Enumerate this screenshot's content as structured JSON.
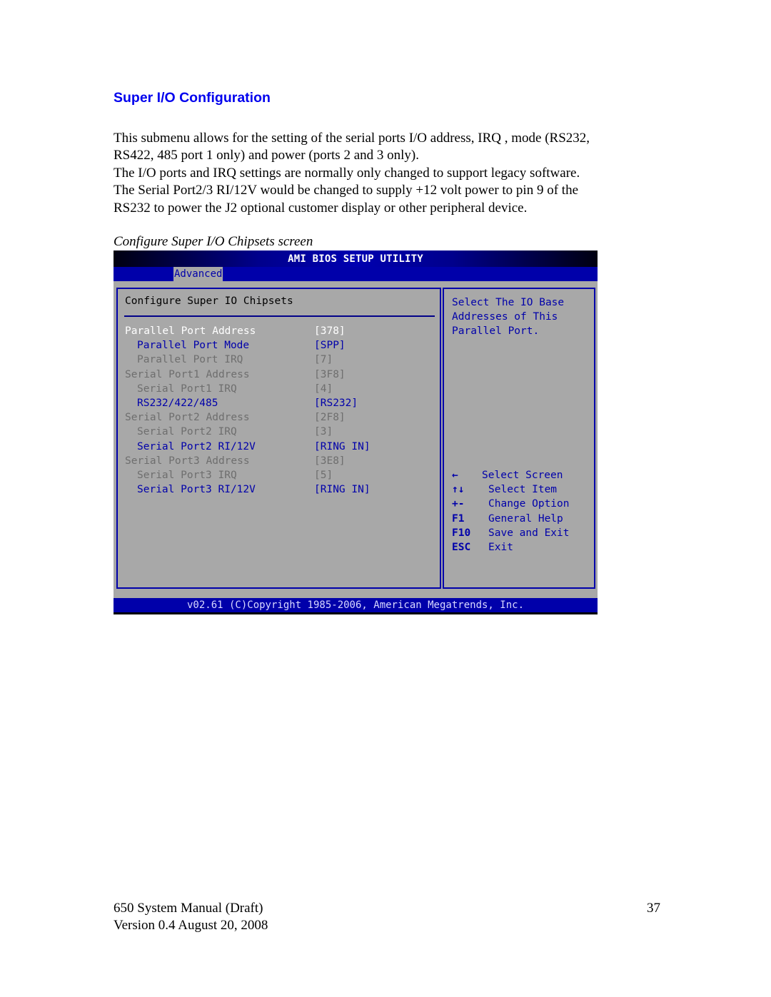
{
  "section": {
    "title": "Super I/O Configuration",
    "paragraph_lines": [
      "This submenu allows for the setting of the serial ports  I/O address, IRQ , mode (RS232,",
      "RS422, 485 port 1 only) and power (ports 2 and 3 only).",
      "The I/O ports and IRQ settings are normally only changed to support legacy software.",
      "The Serial Port2/3 RI/12V would be changed to supply +12 volt power to pin 9 of the",
      "RS232 to power the J2 optional customer display or other peripheral device."
    ],
    "caption": "Configure Super I/O Chipsets screen"
  },
  "bios": {
    "title": "AMI BIOS SETUP UTILITY",
    "active_tab": "Advanced",
    "heading": "Configure Super IO Chipsets",
    "items": [
      {
        "label": "Parallel Port Address",
        "value": "[378]",
        "state": "selected",
        "indent": 0
      },
      {
        "label": "Parallel Port Mode",
        "value": "[SPP]",
        "state": "enabled",
        "indent": 1
      },
      {
        "label": "Parallel Port IRQ",
        "value": "[7]",
        "state": "disabled",
        "indent": 1
      },
      {
        "label": "Serial Port1 Address",
        "value": "[3F8]",
        "state": "disabled",
        "indent": 0
      },
      {
        "label": "Serial Port1 IRQ",
        "value": "[4]",
        "state": "disabled",
        "indent": 1
      },
      {
        "label": "RS232/422/485",
        "value": "[RS232]",
        "state": "enabled",
        "indent": 1
      },
      {
        "label": "Serial Port2 Address",
        "value": "[2F8]",
        "state": "disabled",
        "indent": 0
      },
      {
        "label": "Serial Port2 IRQ",
        "value": "[3]",
        "state": "disabled",
        "indent": 1
      },
      {
        "label": "Serial Port2 RI/12V",
        "value": "[RING IN]",
        "state": "enabled",
        "indent": 1
      },
      {
        "label": "Serial Port3 Address",
        "value": "[3E8]",
        "state": "disabled",
        "indent": 0
      },
      {
        "label": "Serial Port3 IRQ",
        "value": "[5]",
        "state": "disabled",
        "indent": 1
      },
      {
        "label": "Serial Port3 RI/12V",
        "value": "[RING IN]",
        "state": "enabled",
        "indent": 1
      }
    ],
    "help_lines": [
      "Select The IO Base",
      "Addresses of This",
      "Parallel Port."
    ],
    "keys": [
      {
        "key": "←",
        "desc": "Select Screen"
      },
      {
        "key": "↑↓",
        "desc": "Select Item"
      },
      {
        "key": "+-",
        "desc": "Change Option"
      },
      {
        "key": "F1",
        "desc": "General Help"
      },
      {
        "key": "F10",
        "desc": "Save and Exit"
      },
      {
        "key": "ESC",
        "desc": "Exit"
      }
    ],
    "footer": "v02.61 (C)Copyright 1985-2006, American Megatrends, Inc.",
    "colors": {
      "background": "#a8a8a8",
      "bar": "#0000aa",
      "selected_text": "#ffffff",
      "enabled_text": "#0000aa",
      "disabled_text": "#6e6e6e"
    }
  },
  "page_footer": {
    "line1": "650 System Manual (Draft)",
    "line2": "Version 0.4 August 20, 2008",
    "page_number": "37"
  }
}
